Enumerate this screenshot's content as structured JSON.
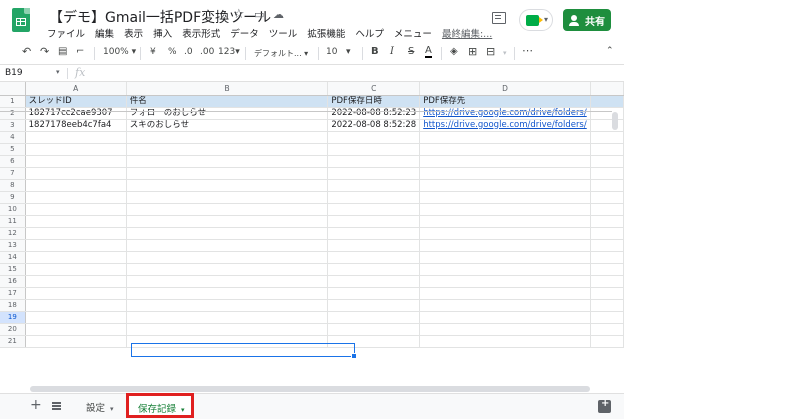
{
  "header": {
    "title": "【デモ】Gmail一括PDF変換ツール",
    "share_label": "共有",
    "menu": [
      "ファイル",
      "編集",
      "表示",
      "挿入",
      "表示形式",
      "データ",
      "ツール",
      "拡張機能",
      "ヘルプ",
      "メニュー"
    ],
    "last_edit": "最終編集:..."
  },
  "toolbar": {
    "zoom": "100%",
    "currency": "¥",
    "percent": "%",
    "dec_decrease": ".0",
    "dec_increase": ".00",
    "more_formats": "123",
    "font": "デフォルト...",
    "font_size": "10",
    "bold": "B",
    "italic": "I",
    "strike": "S",
    "text_color": "A",
    "more": "⋯"
  },
  "formula_bar": {
    "cell_ref": "B19",
    "fx": "fx"
  },
  "sheet": {
    "columns": [
      "A",
      "B",
      "C",
      "D"
    ],
    "row_count": 21,
    "selected_row": 19,
    "rows": [
      [
        "スレッドID",
        "件名",
        "PDF保存日時",
        "PDF保存先"
      ],
      [
        "182717cc2cae9307",
        "フォローのおしらせ",
        "2022-08-08 8:52:23",
        "https://drive.google.com/drive/folders/"
      ],
      [
        "1827178eeb4c7fa4",
        "スキのおしらせ",
        "2022-08-08 8:52:28",
        "https://drive.google.com/drive/folders/"
      ]
    ]
  },
  "tabs": [
    {
      "label": "設定"
    },
    {
      "label": "保存記録"
    }
  ],
  "colors": {
    "header_fill": "#cfe2f3",
    "share_green": "#1e8e3e",
    "link": "#1155cc",
    "highlight": "#e02020"
  }
}
